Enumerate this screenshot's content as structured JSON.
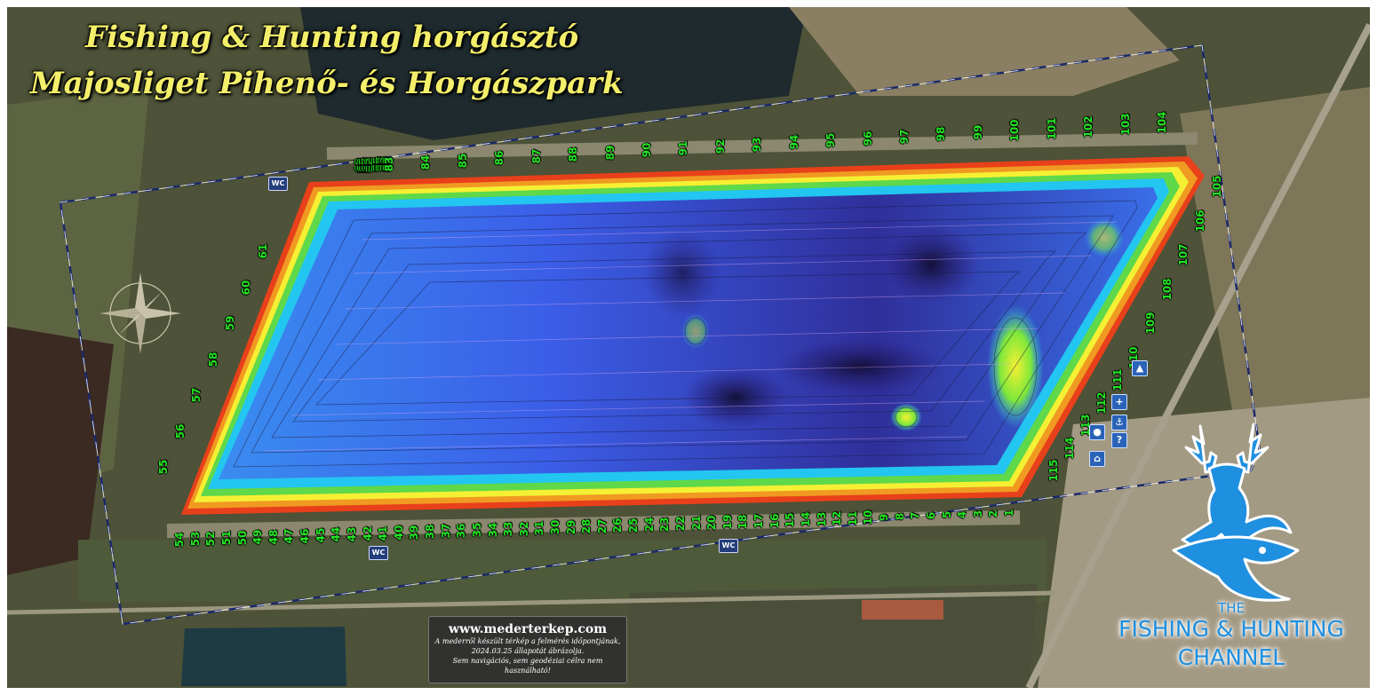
{
  "map": {
    "title_line1": "Fishing & Hunting horgásztó",
    "title_line2": "Majosliget Pihenő- és Horgászpark"
  },
  "wc_label": "WC",
  "pegs_north": [
    "62",
    "63",
    "64",
    "65",
    "66",
    "67",
    "68",
    "69",
    "70",
    "71",
    "72",
    "73",
    "74",
    "75",
    "76",
    "77",
    "78",
    "79",
    "80",
    "81",
    "82",
    "83",
    "84",
    "85",
    "86",
    "87",
    "88",
    "89",
    "90",
    "91",
    "92",
    "93",
    "94",
    "95",
    "96",
    "97",
    "98",
    "99",
    "100",
    "101",
    "102",
    "103",
    "104"
  ],
  "pegs_east": [
    "105",
    "106",
    "107",
    "108",
    "109",
    "110",
    "111",
    "112",
    "113",
    "114",
    "115"
  ],
  "pegs_south": [
    "54",
    "53",
    "52",
    "51",
    "50",
    "49",
    "48",
    "47",
    "46",
    "45",
    "44",
    "43",
    "42",
    "41",
    "40",
    "39",
    "38",
    "37",
    "36",
    "35",
    "34",
    "33",
    "32",
    "31",
    "30",
    "29",
    "28",
    "27",
    "26",
    "25",
    "24",
    "23",
    "22",
    "21",
    "20",
    "19",
    "18",
    "17",
    "16",
    "15",
    "14",
    "13",
    "12",
    "11",
    "10",
    "9",
    "8",
    "7",
    "6",
    "5",
    "4",
    "3",
    "2",
    "1"
  ],
  "pegs_west": [
    "55",
    "56",
    "57",
    "58",
    "59",
    "60",
    "61"
  ],
  "info": {
    "url": "www.mederterkep.com",
    "line1": "A mederről készült térkép a felmérés időpontjának,",
    "line2": "2024.03.25 állapotát ábrázolja.",
    "line3": "Sem navigációs, sem geodéziai célra nem használható!"
  },
  "logo": {
    "the": "THE",
    "main": "FISHING & HUNTING",
    "channel": "CHANNEL"
  },
  "colors": {
    "deep": "#2a1c7a",
    "mid": "#3a5ae8",
    "shallow": "#22c6f0",
    "shore_yellow": "#f5f033",
    "shore_red": "#e8401a",
    "peg_green": "#23e623",
    "brand_blue": "#1f8fe0"
  }
}
